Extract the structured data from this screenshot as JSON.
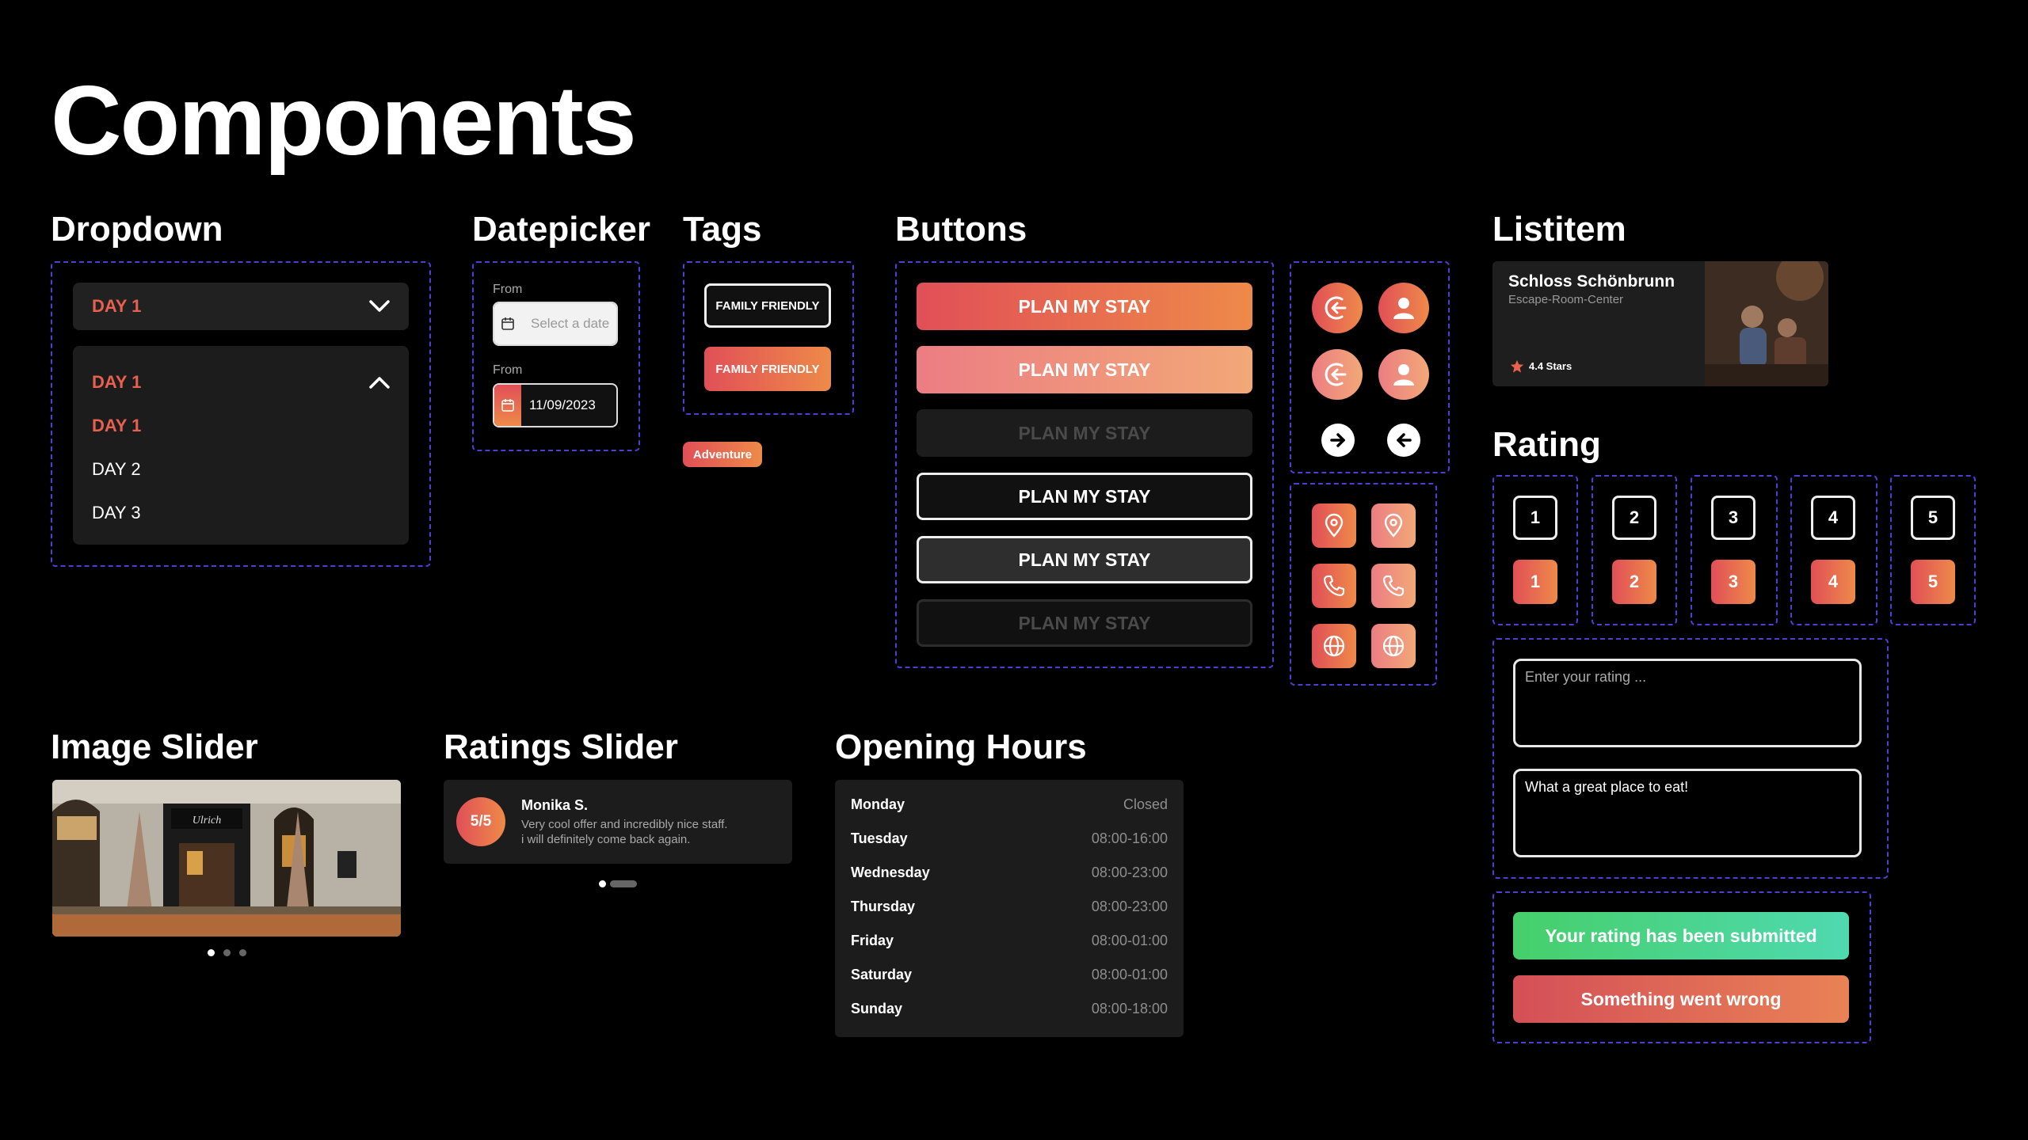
{
  "page_title": "Components",
  "sections": {
    "dropdown": "Dropdown",
    "datepicker": "Datepicker",
    "tags": "Tags",
    "buttons": "Buttons",
    "listitem": "Listitem",
    "rating": "Rating",
    "image_slider": "Image Slider",
    "ratings_slider": "Ratings Slider",
    "opening_hours": "Opening Hours"
  },
  "dropdown": {
    "closed_value": "DAY 1",
    "open_value": "DAY 1",
    "options": [
      "DAY 1",
      "DAY 2",
      "DAY 3"
    ]
  },
  "datepicker": {
    "label_empty": "From",
    "placeholder": "Select a date",
    "label_filled": "From",
    "value": "11/09/2023"
  },
  "tags": {
    "outline": "FAMILY FRIENDLY",
    "filled": "FAMILY FRIENDLY",
    "small": "Adventure"
  },
  "buttons": {
    "primary": "PLAN MY STAY",
    "primary_hover": "PLAN MY STAY",
    "primary_disabled": "PLAN MY STAY",
    "outline": "PLAN MY STAY",
    "outline_hover": "PLAN MY STAY",
    "outline_disabled": "PLAN MY STAY"
  },
  "icon_buttons": {
    "round": [
      "logout-icon",
      "user-icon",
      "arrow-right-icon",
      "arrow-left-icon"
    ],
    "square": [
      "location-pin-icon",
      "phone-icon",
      "globe-icon"
    ]
  },
  "listitem": {
    "title": "Schloss Schönbrunn",
    "subtitle": "Escape-Room-Center",
    "stars": "4.4 Stars"
  },
  "rating": {
    "numbers": [
      "1",
      "2",
      "3",
      "4",
      "5"
    ],
    "placeholder": "Enter your rating ...",
    "filled_value": "What a great place to eat!",
    "success_message": "Your rating has been submitted",
    "error_message": "Something went wrong"
  },
  "image_slider": {
    "dots": 3,
    "active_dot": 1,
    "sign_text": "Ulrich"
  },
  "ratings_slider": {
    "score": "5/5",
    "name": "Monika S.",
    "text_line1": "Very cool offer and incredibly nice staff.",
    "text_line2": "i will definitely come back again."
  },
  "opening_hours": [
    {
      "day": "Monday",
      "time": "Closed"
    },
    {
      "day": "Tuesday",
      "time": "08:00-16:00"
    },
    {
      "day": "Wednesday",
      "time": "08:00-23:00"
    },
    {
      "day": "Thursday",
      "time": "08:00-23:00"
    },
    {
      "day": "Friday",
      "time": "08:00-01:00"
    },
    {
      "day": "Saturday",
      "time": "08:00-01:00"
    },
    {
      "day": "Sunday",
      "time": "08:00-18:00"
    }
  ],
  "colors": {
    "background": "#000000",
    "accent_start": "#e14f57",
    "accent_end": "#ee8a49",
    "dashed_border": "#4b3fd6",
    "success_start": "#46cf6a",
    "success_end": "#4fd9b0",
    "card": "#1c1c1c"
  }
}
